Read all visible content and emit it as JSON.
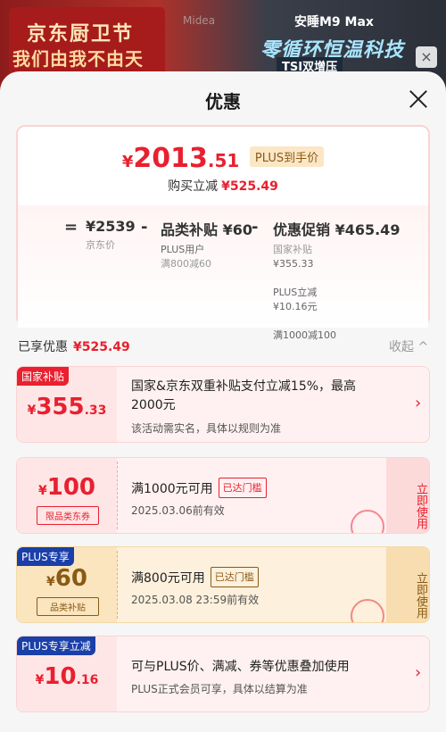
{
  "banner": {
    "title": "京东厨卫节",
    "subtitle": "我们由我不由天",
    "brand": "Midea",
    "model": "安睡M9 Max",
    "headline": "零循环恒温科技",
    "tag": "TSI双增压"
  },
  "sheet": {
    "title": "优惠"
  },
  "summary": {
    "price_yen": "¥",
    "price_int": "2013",
    "price_dec": ".51",
    "plus_tag": "PLUS到手价",
    "reduce_label": "购买立减",
    "reduce_value": "¥525.49",
    "eq": "=",
    "jd_price": "¥2539",
    "jd_price_label": "京东价",
    "minus1": "-",
    "cat_subsidy": "品类补贴 ¥60",
    "cat_user": "PLUS用户",
    "cat_rule": "满800减60",
    "minus2": "-",
    "promo": "优惠促销 ¥465.49",
    "promo_l1": "国家补贴",
    "promo_v1": "¥355.33",
    "promo_l2": "PLUS立减",
    "promo_v2": "¥10.16元",
    "promo_l3": "满1000减100"
  },
  "enjoyed": {
    "label": "已享优惠",
    "value": "¥525.49",
    "collapse": "收起 ^"
  },
  "cards": [
    {
      "tag": "国家补贴",
      "yen": "¥",
      "int": "355",
      "dec": ".33",
      "line1": "国家&京东双重补贴支付立减15%，最高",
      "line2": "2000元",
      "line3": "该活动需实名，具体以规则为准",
      "chevron": "›"
    },
    {
      "yen": "¥",
      "int": "100",
      "subtag": "限品类东券",
      "line1": "满1000元可用",
      "reached": "已达门槛",
      "line2": "2025.03.06前有效",
      "button": "立即使用"
    },
    {
      "tag": "PLUS专享",
      "yen": "¥",
      "int": "60",
      "subtag": "品类补贴",
      "line1": "满800元可用",
      "reached": "已达门槛",
      "line2": "2025.03.08 23:59前有效",
      "button": "立即使用"
    },
    {
      "tag": "PLUS专享立减",
      "yen": "¥",
      "int": "10",
      "dec": ".16",
      "line1": "可与PLUS价、满减、券等优惠叠加使用",
      "line2": "PLUS正式会员可享，具体以结算为准",
      "chevron": "›"
    }
  ],
  "colors": {
    "accent": "#e8202f",
    "gold": "#8a5a14",
    "blue_tag": "#1a3fa8"
  }
}
